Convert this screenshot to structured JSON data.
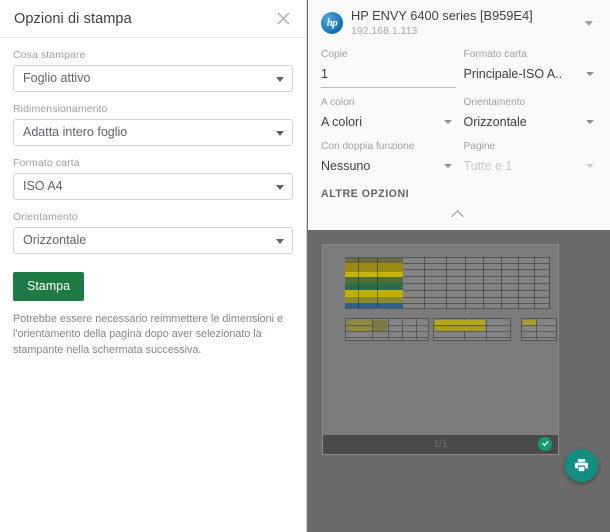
{
  "left": {
    "title": "Opzioni di stampa",
    "close_icon": "close-icon",
    "fields": [
      {
        "label": "Cosa stampare",
        "value": "Foglio attivo"
      },
      {
        "label": "Ridimensionamento",
        "value": "Adatta intero foglio"
      },
      {
        "label": "Formato carta",
        "value": "ISO A4"
      },
      {
        "label": "Orientamento",
        "value": "Orizzontale"
      }
    ],
    "print_button": "Stampa",
    "note": "Potrebbe essere necessario reimmettere le dimensioni e l'orientamento della pagina dopo aver selezionato la stampante nella schermata successiva."
  },
  "right": {
    "printer": {
      "logo_text": "hp",
      "name": "HP ENVY 6400 series [B959E4]",
      "address": "192.168.1.113"
    },
    "options": [
      {
        "label": "Copie",
        "value": "1",
        "type": "text",
        "disabled": false
      },
      {
        "label": "Formato carta",
        "value": "Principale-ISO A..",
        "type": "select",
        "disabled": false
      },
      {
        "label": "A colori",
        "value": "A colori",
        "type": "select",
        "disabled": false
      },
      {
        "label": "Orientamento",
        "value": "Orizzontale",
        "type": "select",
        "disabled": false
      },
      {
        "label": "Con doppia funzione",
        "value": "Nessuno",
        "type": "select",
        "disabled": false
      },
      {
        "label": "Pagine",
        "value": "Tutte e 1",
        "type": "select",
        "disabled": true
      }
    ],
    "more_options": "ALTRE OPZIONI",
    "preview": {
      "page_indicator": "1/1",
      "status_icon": "check-circle-icon"
    },
    "fab_icon": "printer-icon"
  },
  "colors": {
    "print_button": "#1d7a45",
    "fab": "#0f9080",
    "check_badge": "#149a6e",
    "hp_blue": "#1a7fc1",
    "backdrop": "#6b6b6b"
  }
}
